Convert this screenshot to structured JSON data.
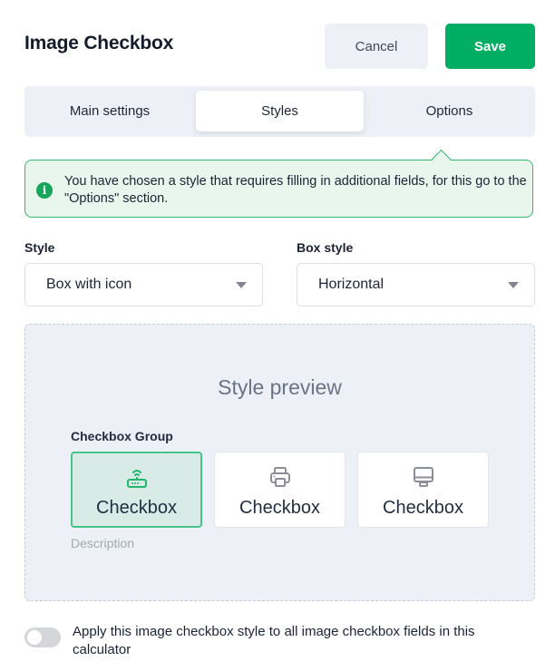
{
  "header": {
    "title": "Image Checkbox",
    "cancel_label": "Cancel",
    "save_label": "Save"
  },
  "tabs": [
    {
      "label": "Main settings",
      "active": false
    },
    {
      "label": "Styles",
      "active": true
    },
    {
      "label": "Options",
      "active": false
    }
  ],
  "notice": {
    "icon": "info-icon",
    "text": "You have chosen a style that requires filling in additional fields, for this go to the \"Options\" section."
  },
  "fields": {
    "style": {
      "label": "Style",
      "value": "Box with icon"
    },
    "box_style": {
      "label": "Box style",
      "value": "Horizontal"
    }
  },
  "preview": {
    "title": "Style preview",
    "group_label": "Checkbox Group",
    "items": [
      {
        "label": "Checkbox",
        "icon": "router-icon",
        "selected": true
      },
      {
        "label": "Checkbox",
        "icon": "printer-icon",
        "selected": false
      },
      {
        "label": "Checkbox",
        "icon": "monitor-icon",
        "selected": false
      }
    ],
    "description": "Description"
  },
  "apply_toggle": {
    "label": "Apply this image checkbox style to all image checkbox fields in this calculator",
    "checked": false
  },
  "colors": {
    "accent": "#00ae63",
    "selected_border": "#47c486",
    "selected_bg": "#d8ebe6"
  }
}
